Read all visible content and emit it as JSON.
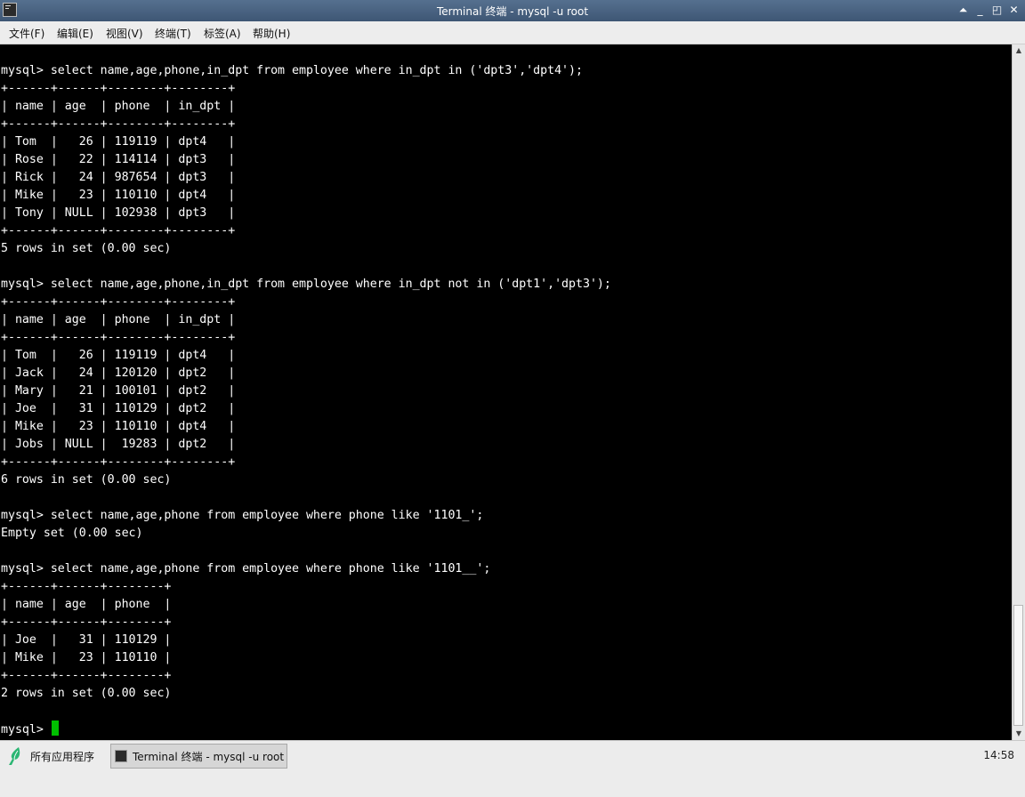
{
  "window": {
    "title": "Terminal 终端 - mysql -u root",
    "controls": {
      "shade": "⏶",
      "minimize": "_",
      "maximize": "◰",
      "close": "✕"
    }
  },
  "menu": [
    "文件(F)",
    "编辑(E)",
    "视图(V)",
    "终端(T)",
    "标签(A)",
    "帮助(H)"
  ],
  "terminal": {
    "lines": [
      "mysql> select name,age,phone,in_dpt from employee where in_dpt in ('dpt3','dpt4');",
      "+------+------+--------+--------+",
      "| name | age  | phone  | in_dpt |",
      "+------+------+--------+--------+",
      "| Tom  |   26 | 119119 | dpt4   |",
      "| Rose |   22 | 114114 | dpt3   |",
      "| Rick |   24 | 987654 | dpt3   |",
      "| Mike |   23 | 110110 | dpt4   |",
      "| Tony | NULL | 102938 | dpt3   |",
      "+------+------+--------+--------+",
      "5 rows in set (0.00 sec)",
      "",
      "mysql> select name,age,phone,in_dpt from employee where in_dpt not in ('dpt1','dpt3');",
      "+------+------+--------+--------+",
      "| name | age  | phone  | in_dpt |",
      "+------+------+--------+--------+",
      "| Tom  |   26 | 119119 | dpt4   |",
      "| Jack |   24 | 120120 | dpt2   |",
      "| Mary |   21 | 100101 | dpt2   |",
      "| Joe  |   31 | 110129 | dpt2   |",
      "| Mike |   23 | 110110 | dpt4   |",
      "| Jobs | NULL |  19283 | dpt2   |",
      "+------+------+--------+--------+",
      "6 rows in set (0.00 sec)",
      "",
      "mysql> select name,age,phone from employee where phone like '1101_';",
      "Empty set (0.00 sec)",
      "",
      "mysql> select name,age,phone from employee where phone like '1101__';",
      "+------+------+--------+",
      "| name | age  | phone  |",
      "+------+------+--------+",
      "| Joe  |   31 | 110129 |",
      "| Mike |   23 | 110110 |",
      "+------+------+--------+",
      "2 rows in set (0.00 sec)",
      "",
      "mysql> "
    ],
    "colors": {
      "background": "#000000",
      "foreground": "#ffffff",
      "cursor": "#00c000"
    }
  },
  "taskbar": {
    "start_label": "所有应用程序",
    "task_label": "Terminal 终端 - mysql -u root",
    "clock": "14:58"
  }
}
